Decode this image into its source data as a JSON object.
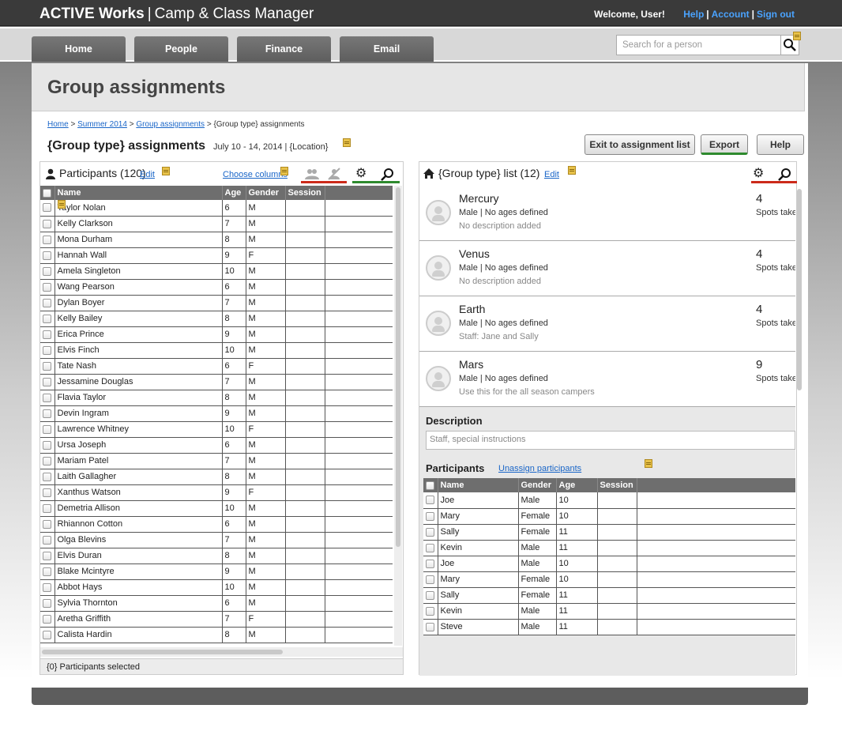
{
  "app": {
    "brand_bold": "ACTIVE Works",
    "brand_sep": "|",
    "brand_rest": "Camp & Class Manager"
  },
  "topbar": {
    "welcome": "Welcome, User!",
    "help": "Help",
    "account": "Account",
    "signout": "Sign out",
    "sep": "|"
  },
  "nav": {
    "home": "Home",
    "people": "People",
    "finance": "Finance",
    "email": "Email"
  },
  "search": {
    "placeholder": "Search for a person"
  },
  "page": {
    "title": "Group assignments"
  },
  "breadcrumb": {
    "home": "Home",
    "season": "Summer 2014",
    "assignments": "Group assignments",
    "current": "{Group type} assignments",
    "sep": ">"
  },
  "subhead": {
    "title": "{Group type} assignments",
    "dates": "July 10 - 14, 2014 | {Location}"
  },
  "buttons": {
    "exit": "Exit to assignment list",
    "export": "Export",
    "help": "Help"
  },
  "participants_panel": {
    "title": "Participants (120)",
    "edit": "Edit",
    "choose_columns": "Choose columns",
    "columns": [
      "Name",
      "Age",
      "Gender",
      "Session"
    ],
    "rows": [
      [
        "Taylor Nolan",
        "6",
        "M"
      ],
      [
        "Kelly Clarkson",
        "7",
        "M"
      ],
      [
        "Mona Durham",
        "8",
        "M"
      ],
      [
        "Hannah Wall",
        "9",
        "F"
      ],
      [
        "Amela Singleton",
        "10",
        "M"
      ],
      [
        "Wang Pearson",
        "6",
        "M"
      ],
      [
        "Dylan Boyer",
        "7",
        "M"
      ],
      [
        "Kelly Bailey",
        "8",
        "M"
      ],
      [
        "Erica Prince",
        "9",
        "M"
      ],
      [
        "Elvis Finch",
        "10",
        "M"
      ],
      [
        "Tate Nash",
        "6",
        "F"
      ],
      [
        "Jessamine Douglas",
        "7",
        "M"
      ],
      [
        "Flavia Taylor",
        "8",
        "M"
      ],
      [
        "Devin Ingram",
        "9",
        "M"
      ],
      [
        "Lawrence Whitney",
        "10",
        "F"
      ],
      [
        "Ursa Joseph",
        "6",
        "M"
      ],
      [
        "Mariam Patel",
        "7",
        "M"
      ],
      [
        "Laith Gallagher",
        "8",
        "M"
      ],
      [
        "Xanthus Watson",
        "9",
        "F"
      ],
      [
        "Demetria Allison",
        "10",
        "M"
      ],
      [
        "Rhiannon Cotton",
        "6",
        "M"
      ],
      [
        "Olga Blevins",
        "7",
        "M"
      ],
      [
        "Elvis Duran",
        "8",
        "M"
      ],
      [
        "Blake Mcintyre",
        "9",
        "M"
      ],
      [
        "Abbot Hays",
        "10",
        "M"
      ],
      [
        "Sylvia Thornton",
        "6",
        "M"
      ],
      [
        "Aretha Griffith",
        "7",
        "F"
      ],
      [
        "Calista Hardin",
        "8",
        "M"
      ]
    ],
    "footer": "{0} Participants selected"
  },
  "groups_panel": {
    "title": "{Group type} list (12)",
    "edit": "Edit",
    "groups": [
      {
        "name": "Mercury",
        "sub": "Male | No ages defined",
        "desc": "No description added",
        "count": "4",
        "spots": "Spots taken"
      },
      {
        "name": "Venus",
        "sub": "Male | No ages defined",
        "desc": "No description added",
        "count": "4",
        "spots": "Spots taken"
      },
      {
        "name": "Earth",
        "sub": "Male | No ages defined",
        "desc": "Staff: Jane and Sally",
        "count": "4",
        "spots": "Spots taken"
      },
      {
        "name": "Mars",
        "sub": "Male | No ages defined",
        "desc": "Use this for the all season campers",
        "count": "9",
        "spots": "Spots taken"
      }
    ],
    "detail": {
      "description_label": "Description",
      "description_placeholder": "Staff, special instructions",
      "participants_label": "Participants",
      "unassign": "Unassign participants",
      "columns": [
        "Name",
        "Gender",
        "Age",
        "Session"
      ],
      "rows": [
        [
          "Joe",
          "Male",
          "10"
        ],
        [
          "Mary",
          "Female",
          "10"
        ],
        [
          "Sally",
          "Female",
          "11"
        ],
        [
          "Kevin",
          "Male",
          "11"
        ],
        [
          "Joe",
          "Male",
          "10"
        ],
        [
          "Mary",
          "Female",
          "10"
        ],
        [
          "Sally",
          "Female",
          "11"
        ],
        [
          "Kevin",
          "Male",
          "11"
        ],
        [
          "Steve",
          "Male",
          "11"
        ]
      ]
    }
  },
  "colors": {
    "accent_link": "#1a66c8",
    "underline_red": "#cc2a1a",
    "underline_green": "#2e8a2e",
    "header_bg": "#3a3a3a"
  }
}
